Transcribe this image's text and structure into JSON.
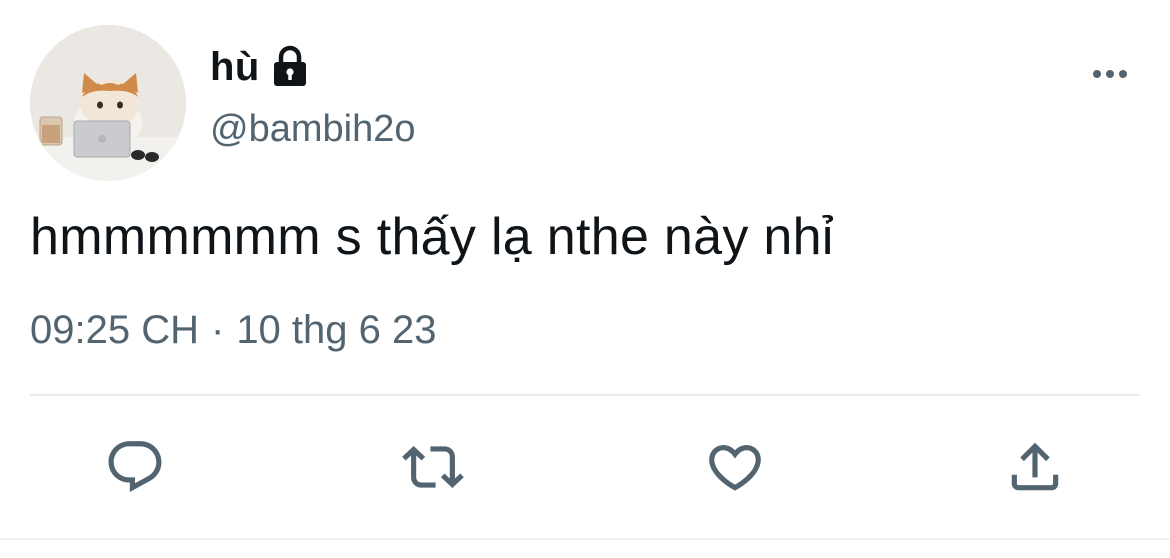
{
  "tweet": {
    "display_name": "hù",
    "handle": "@bambih2o",
    "text": "hmmmmmm s thấy lạ nthe này nhỉ",
    "time": "09:25 CH",
    "separator": "·",
    "date": "10 thg 6 23"
  },
  "icons": {
    "lock": "lock-icon",
    "more": "more-horizontal-icon",
    "reply": "reply-icon",
    "retweet": "retweet-icon",
    "like": "heart-icon",
    "share": "share-icon"
  },
  "colors": {
    "text": "#0f1419",
    "secondary": "#536471",
    "divider": "#e6ecf0"
  }
}
